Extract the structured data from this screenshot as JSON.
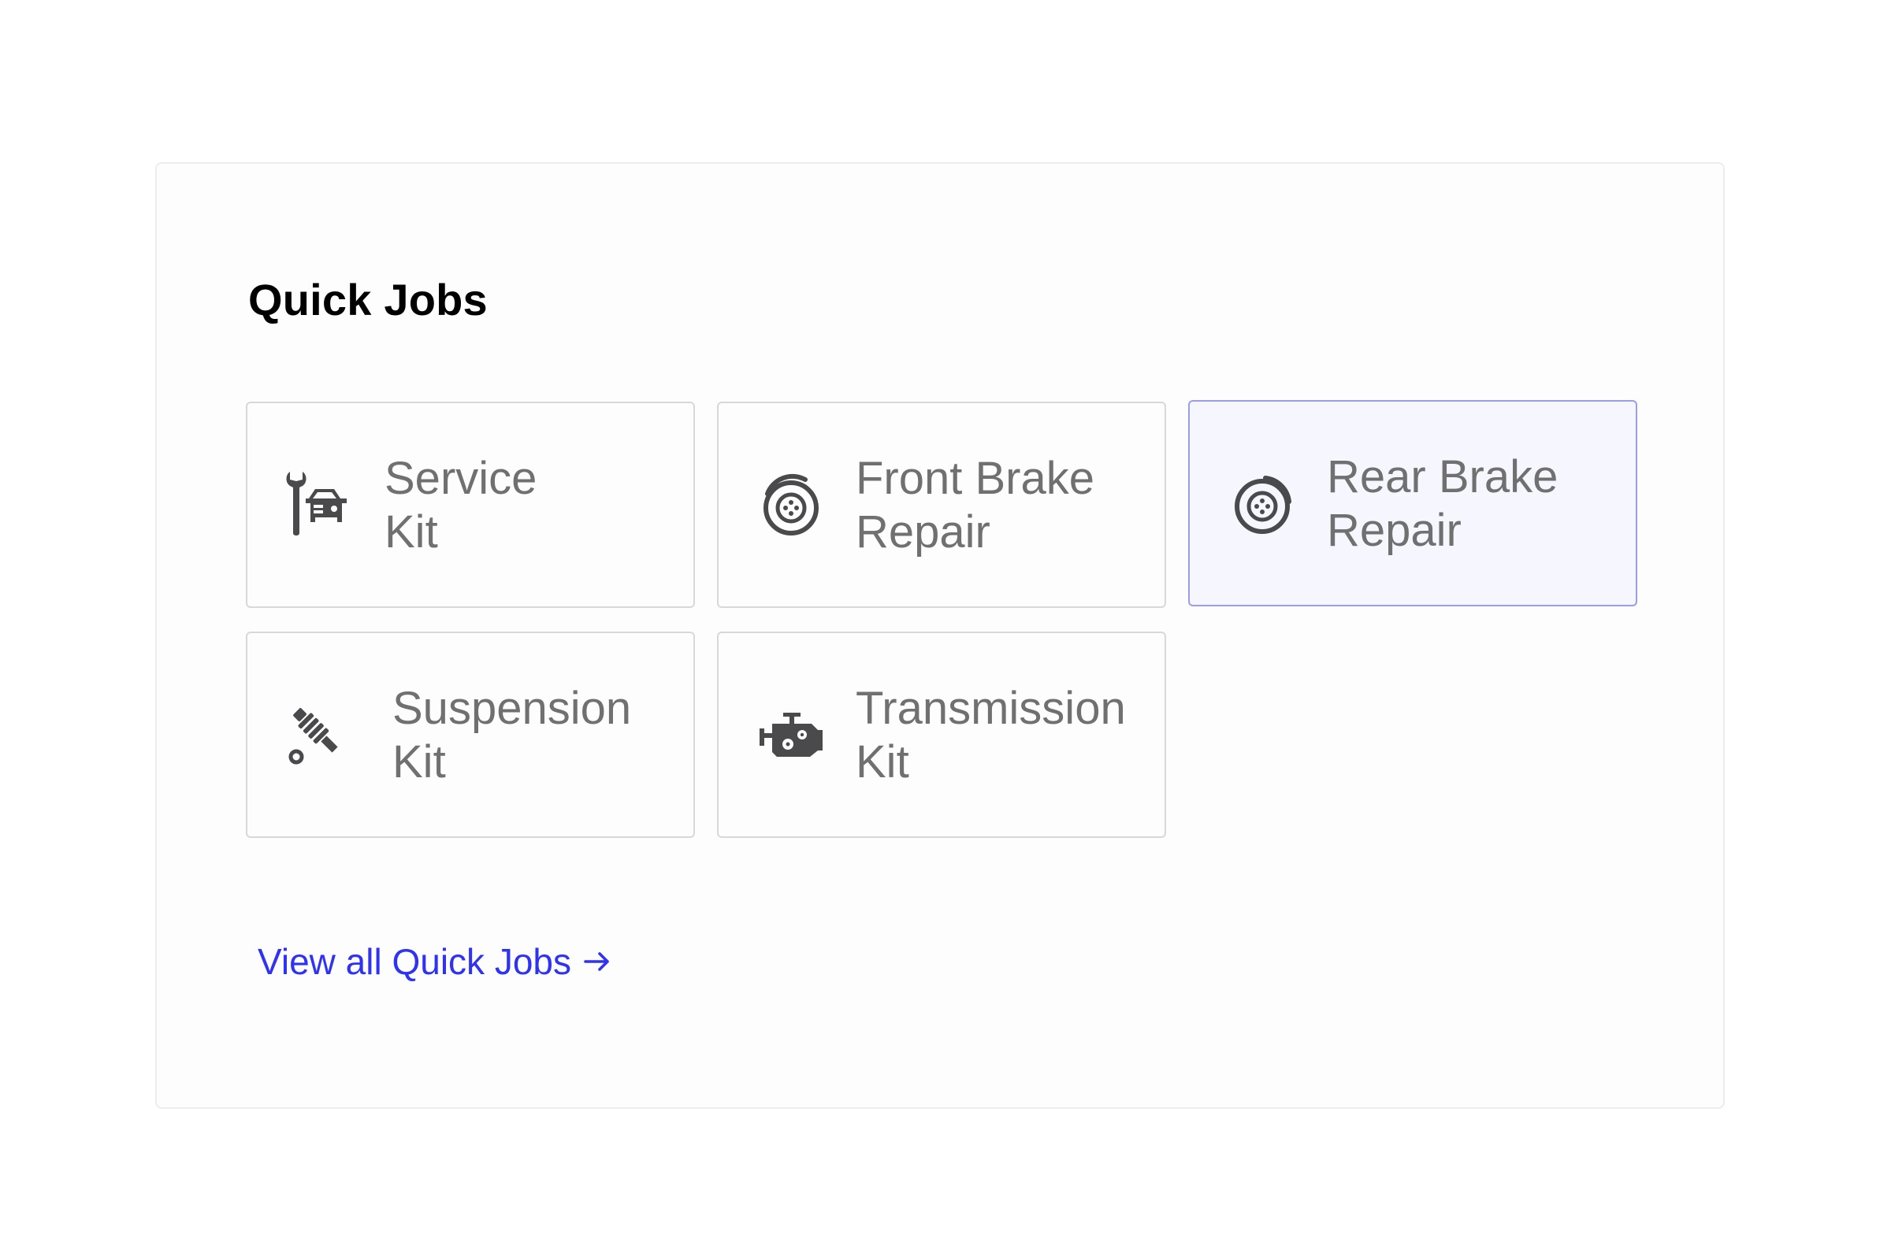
{
  "panel": {
    "title": "Quick Jobs"
  },
  "tiles": [
    {
      "label": "Service\nKit",
      "icon": "service-wrench-car-icon",
      "selected": false
    },
    {
      "label": "Front Brake\nRepair",
      "icon": "brake-disc-icon",
      "selected": false
    },
    {
      "label": "Rear Brake\nRepair",
      "icon": "brake-disc-icon",
      "selected": true
    },
    {
      "label": "Suspension\nKit",
      "icon": "shock-absorber-icon",
      "selected": false
    },
    {
      "label": "Transmission\nKit",
      "icon": "engine-gears-icon",
      "selected": false
    }
  ],
  "footer": {
    "view_all_label": "View all Quick Jobs",
    "arrow_icon": "arrow-right-icon"
  },
  "colors": {
    "icon": "#4a4a4c",
    "label": "#707070",
    "link": "#2e32f5",
    "selected_bg": "#f6f6fe",
    "selected_border": "#9a9ee6"
  }
}
